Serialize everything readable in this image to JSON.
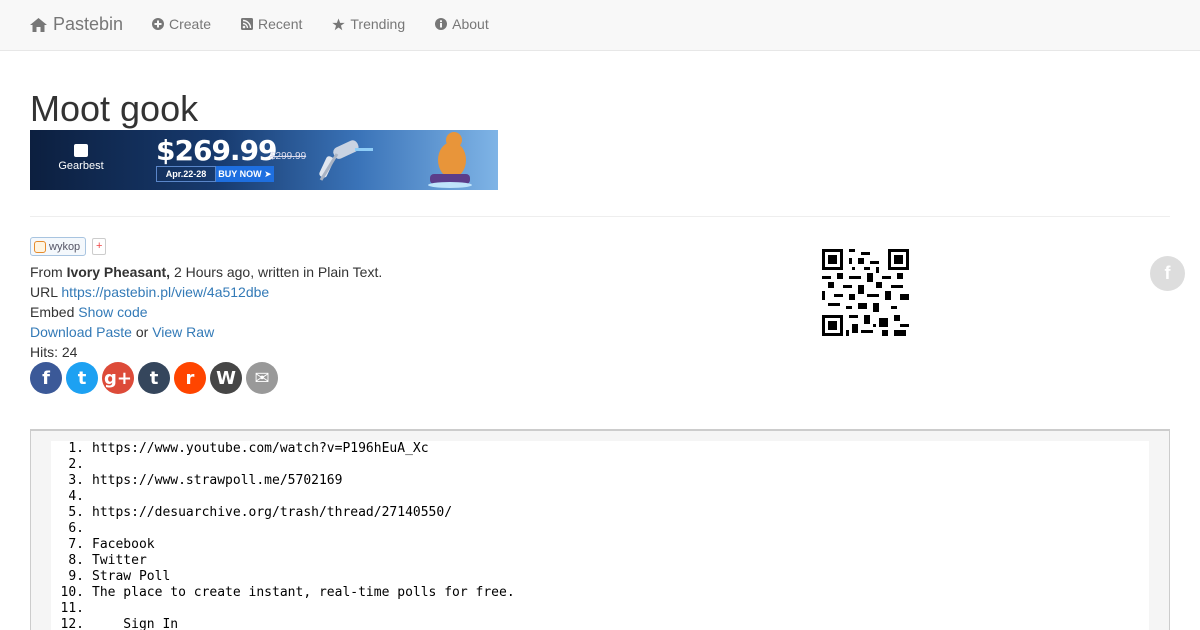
{
  "nav": {
    "brand": "Pastebin",
    "items": [
      {
        "label": "Create",
        "icon": "plus-circle-icon"
      },
      {
        "label": "Recent",
        "icon": "rss-icon"
      },
      {
        "label": "Trending",
        "icon": "star-icon"
      },
      {
        "label": "About",
        "icon": "info-circle-icon"
      }
    ]
  },
  "title": "Moot gook",
  "banner": {
    "brand": "Gearbest",
    "price": "$269.99",
    "old_price": "$299.99",
    "date": "Apr.22-28",
    "cta": "BUY NOW ➤"
  },
  "wykop": {
    "label": "wykop",
    "plus": "+"
  },
  "meta": {
    "from_label": "From",
    "author": "Ivory Pheasant,",
    "time": "2 Hours ago, written in Plain Text.",
    "url_label": "URL",
    "url": "https://pastebin.pl/view/4a512dbe",
    "embed_label": "Embed",
    "embed_link": "Show code",
    "download": "Download Paste",
    "or": "or",
    "raw": "View Raw",
    "hits": "Hits: 24"
  },
  "share": [
    {
      "name": "facebook",
      "glyph": "f",
      "color": "#3b5998"
    },
    {
      "name": "twitter",
      "glyph": "t",
      "color": "#1da1f2"
    },
    {
      "name": "google-plus",
      "glyph": "g+",
      "color": "#dd4b39"
    },
    {
      "name": "tumblr",
      "glyph": "t",
      "color": "#35465c"
    },
    {
      "name": "reddit",
      "glyph": "r",
      "color": "#ff4500"
    },
    {
      "name": "wordpress",
      "glyph": "W",
      "color": "#464646"
    },
    {
      "name": "email",
      "glyph": "✉",
      "color": "#999999"
    }
  ],
  "code_lines": [
    {
      "n": "1.",
      "t": "https://www.youtube.com/watch?v=P196hEuA_Xc"
    },
    {
      "n": "2.",
      "t": ""
    },
    {
      "n": "3.",
      "t": "https://www.strawpoll.me/5702169"
    },
    {
      "n": "4.",
      "t": ""
    },
    {
      "n": "5.",
      "t": "https://desuarchive.org/trash/thread/27140550/"
    },
    {
      "n": "6.",
      "t": ""
    },
    {
      "n": "7.",
      "t": "Facebook"
    },
    {
      "n": "8.",
      "t": "Twitter"
    },
    {
      "n": "9.",
      "t": "Straw Poll"
    },
    {
      "n": "10.",
      "t": "The place to create instant, real-time polls for free."
    },
    {
      "n": "11.",
      "t": ""
    },
    {
      "n": "12.",
      "t": "    Sign In"
    }
  ]
}
